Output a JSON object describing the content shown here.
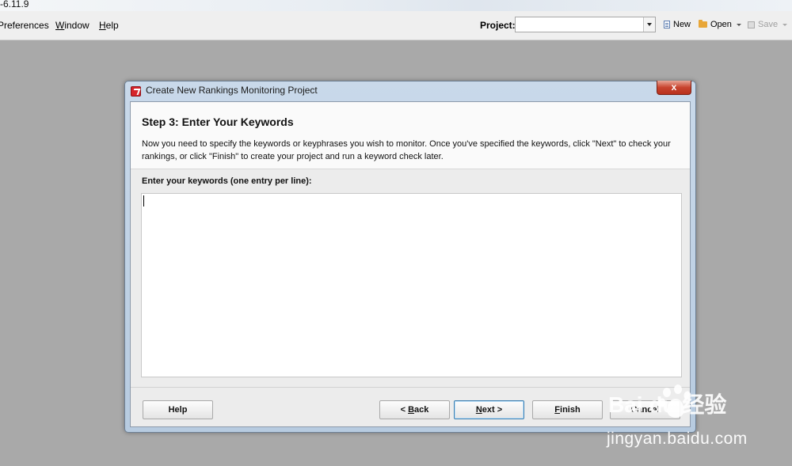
{
  "window": {
    "title_fragment": "-6.11.9"
  },
  "menu": {
    "items": [
      {
        "label": "Preferences",
        "mnemonic": ""
      },
      {
        "label": "Window",
        "mnemonic": "W"
      },
      {
        "label": "Help",
        "mnemonic": "H"
      }
    ]
  },
  "toolbar": {
    "project_label": "Project:",
    "project_value": "",
    "new_label": "New",
    "open_label": "Open",
    "save_label": "Save"
  },
  "dialog": {
    "title": "Create New Rankings Monitoring Project",
    "close_label": "x",
    "step_title": "Step 3: Enter Your Keywords",
    "step_description": "Now you need to specify the keywords or keyphrases you wish to monitor. Once you've specified the keywords, click \"Next\" to check your rankings, or click \"Finish\" to create your project and run a keyword check later.",
    "keywords_label": "Enter your keywords (one entry per line):",
    "keywords_value": "",
    "buttons": {
      "help": "Help",
      "back_prefix": "< ",
      "back_mn": "B",
      "back_rest": "ack",
      "next_mn": "N",
      "next_rest": "ext >",
      "finish_mn": "F",
      "finish_rest": "inish",
      "cancel": "Cancel"
    }
  },
  "watermark": {
    "logo": "Bai du 经验",
    "text": "jingyan.baidu.com"
  },
  "colors": {
    "desktop": "#a9a9a9",
    "dialog_frame": "#c9d9ea",
    "close_button": "#c8442f",
    "default_button_border": "#3c7fb1"
  }
}
